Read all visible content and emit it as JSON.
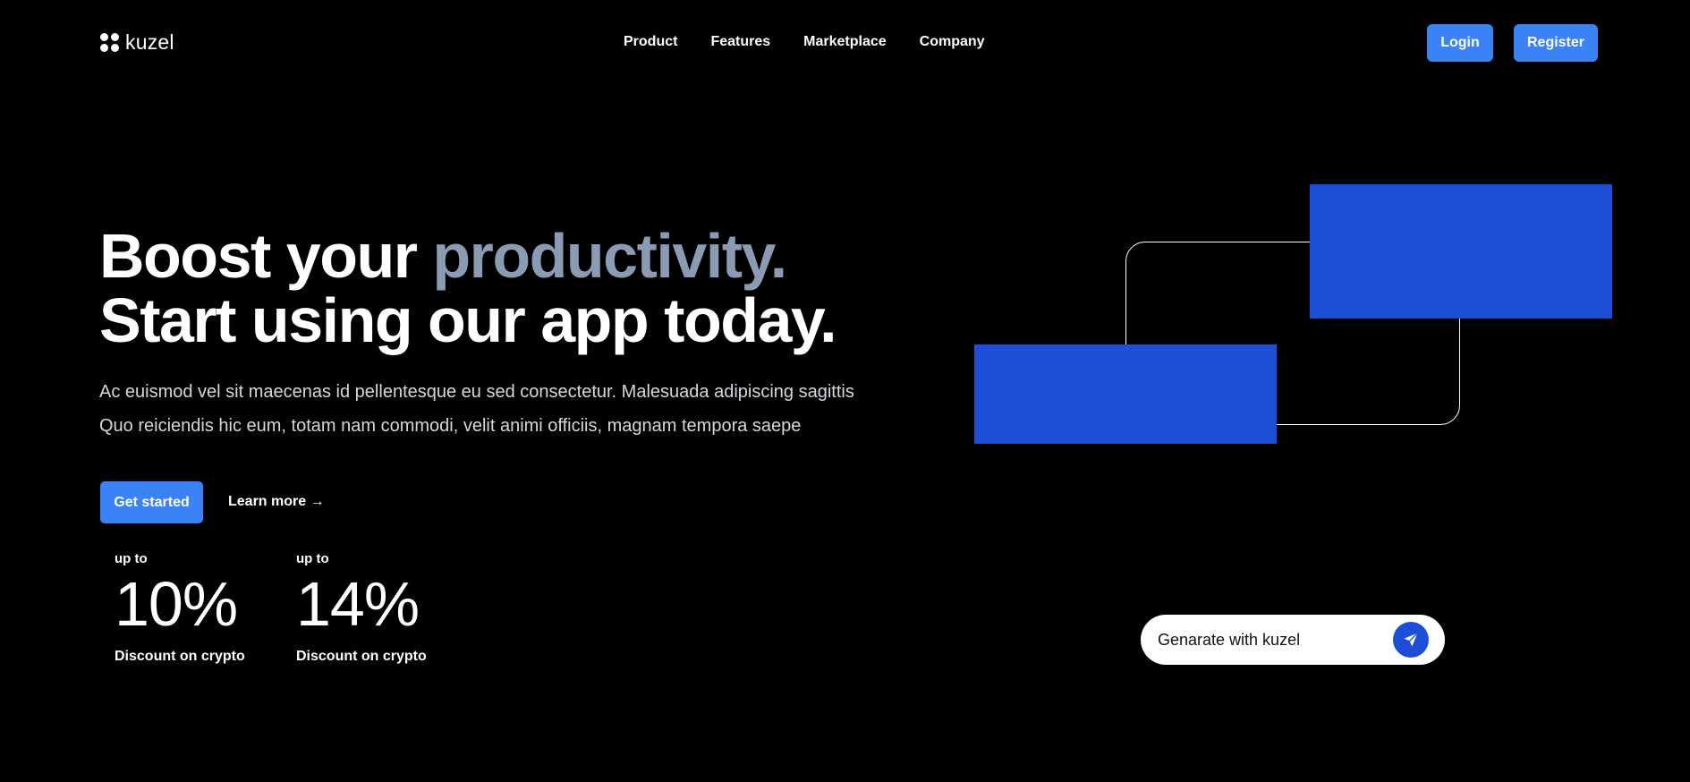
{
  "brand": {
    "name": "kuzel",
    "logo_icon": "four-dots-logo-icon"
  },
  "nav": {
    "items": [
      {
        "label": "Product"
      },
      {
        "label": "Features"
      },
      {
        "label": "Marketplace"
      },
      {
        "label": "Company"
      }
    ],
    "login_label": "Login",
    "register_label": "Register"
  },
  "hero": {
    "title_part1": "Boost your ",
    "title_accent": "productivity.",
    "title_line2": "Start using our app today.",
    "description_line1": "Ac euismod vel sit maecenas id pellentesque eu sed consectetur. Malesuada adipiscing sagittis",
    "description_line2": "Quo reiciendis hic eum, totam nam commodi, velit animi officiis, magnam tempora saepe",
    "cta_primary": "Get started",
    "cta_secondary": "Learn more →"
  },
  "stats": [
    {
      "prefix": "up to",
      "value": "10%",
      "caption": "Discount on crypto"
    },
    {
      "prefix": "up to",
      "value": "14%",
      "caption": "Discount on crypto"
    }
  ],
  "generate": {
    "label": "Genarate with kuzel",
    "button_icon": "send-icon"
  },
  "colors": {
    "background": "#000000",
    "primary_button": "#3b82f6",
    "accent_blue": "#1d4ed8",
    "title_accent": "#8b9bb4"
  }
}
